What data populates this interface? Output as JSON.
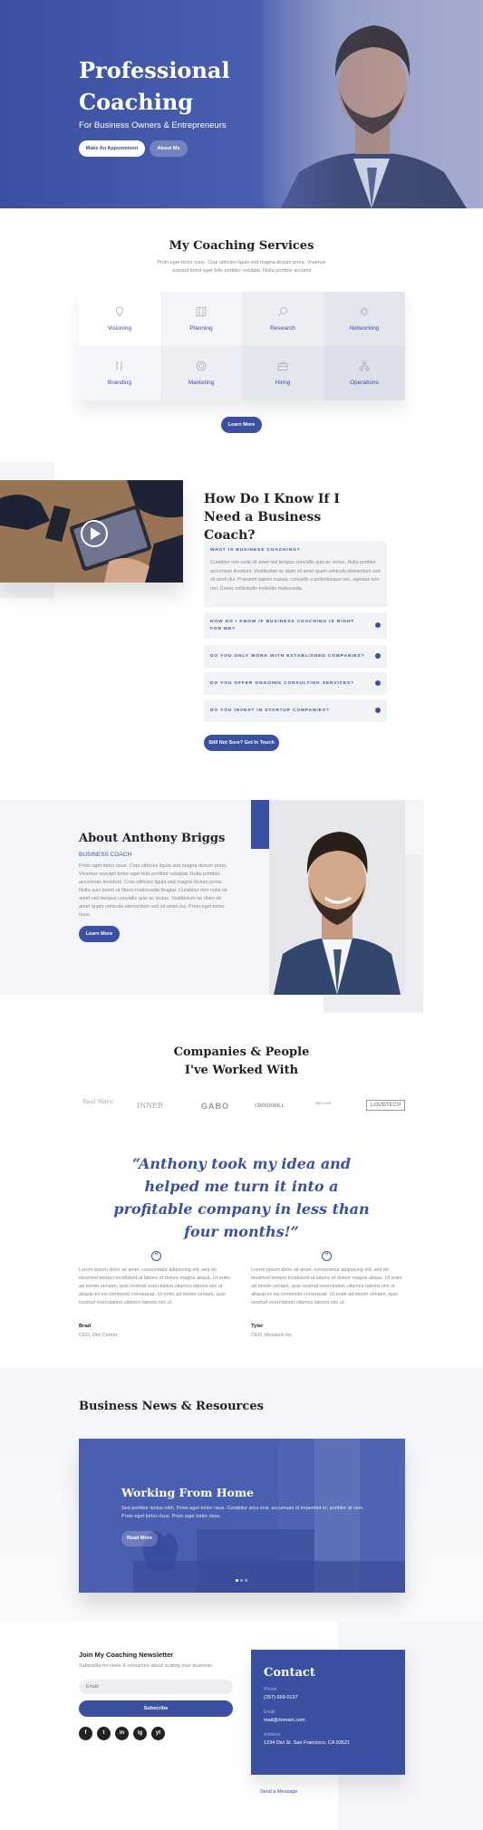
{
  "hero": {
    "title": "Professional Coaching",
    "subtitle": "For Business Owners & Entrepreneurs",
    "primary_button": "Make An Appointment",
    "secondary_button": "About Me"
  },
  "services": {
    "title": "My Coaching Services",
    "description": "Proin eget tortor risus. Cras ultricies ligula sed magna dictum porta. Vivamus suscipit tortor eget felis porttitor volutpat. Nulla porttitor accums",
    "items": [
      {
        "label": "Visioning",
        "icon": "lightbulb-icon"
      },
      {
        "label": "Planning",
        "icon": "map-icon"
      },
      {
        "label": "Research",
        "icon": "search-icon"
      },
      {
        "label": "Networking",
        "icon": "network-icon"
      },
      {
        "label": "Branding",
        "icon": "pen-icon"
      },
      {
        "label": "Marketing",
        "icon": "target-icon"
      },
      {
        "label": "Hiring",
        "icon": "briefcase-icon"
      },
      {
        "label": "Operations",
        "icon": "org-chart-icon"
      }
    ],
    "button": "Learn More"
  },
  "faq": {
    "title": "How Do I Know If I Need a Business Coach?",
    "open_question": "WHAT IS BUSINESS COACHING?",
    "open_answer": "Curabitur non nulla sit amet nisl tempus convallis quis ac lectus. Nulla porttitor accumsan tincidunt. Vestibulum ac diam sit amet quam vehicula elementum sed sit amet dui. Praesent sapien massa, convallis a pellentesque nec, egestas non nisi. Donec sollicitudin molestie malesuada.",
    "questions": [
      "HOW DO I KNOW IF BUSINESS COACHING IS RIGHT FOR ME?",
      "DO YOU ONLY WORK WITH ESTABLISHED COMPANIES?",
      "DO YOU OFFER ONGOING CONSULTING SERVICES?",
      "DO YOU INVEST IN STARTUP COMPANIES?"
    ],
    "button": "Still Not Sure? Get In Touch"
  },
  "about": {
    "title": "About Anthony Briggs",
    "subtitle": "BUSINESS COACH",
    "body": "Proin eget tortor risus. Cras ultricies ligula sed magna dictum porta. Vivamus suscipit tortor eget felis porttitor volutpat. Nulla porttitor accumsan tincidunt. Cras ultricies ligula sed magna dictum porta. Nulla quis lorem ut libero malesuada feugiat. Curabitur non nulla sit amet nisl tempus convallis quis ac lectus. Vestibulum ac diam sit amet quam vehicula elementum sed sit amet dui. Proin eget tortor risus.",
    "button": "Learn More"
  },
  "companies": {
    "title": "Companies & People I've Worked With",
    "logos": [
      "Real Wave",
      "INNER",
      "GABO",
      "CROSSWILL",
      "Zen Link",
      "LOUDTECH"
    ]
  },
  "quote": {
    "text": "“Anthony took my idea and helped me turn it into a profitable company in less than four months!”"
  },
  "testimonials": [
    {
      "text": "Lorem ipsum dolor sit amet, consectetur adipiscing elit, sed do eiusmod tempor incididunt ut labore et dolore magna aliqua. Ut enim ad minim veniam, quis nostrud exercitation ullamco laboris nisi ut aliquip ex ea commodo consequat. Ut enim ad minim veniam, quis nostrud exercitation ullamco laboris nisi ut.",
      "name": "Brad",
      "role": "CEO, Divi Corner"
    },
    {
      "text": "Lorem ipsum dolor sit amet, consectetur adipiscing elit, sed do eiusmod tempor incididunt ut labore et dolore magna aliqua. Ut enim ad minim veniam, quis nostrud exercitation ullamco laboris nisi ut aliquip ex ea commodo consequat. Ut enim ad minim veniam, quis nostrud exercitation ullamco laboris nisi ut.",
      "name": "Tyler",
      "role": "CEO, Monarch Inc"
    }
  ],
  "news": {
    "title": "Business News & Resources",
    "slide_title": "Working From Home",
    "slide_text": "Sed porttitor lectus nibh. Proin eget tortor risus. Curabitur arcu erat, accumsan id imperdiet et, porttitor at sem. Proin eget tortor risus. Proin eget tortor risus.",
    "slide_button": "Read More"
  },
  "newsletter": {
    "title": "Join My Coaching Newsletter",
    "text": "Subscribe for news & resources about scaling your business",
    "email_placeholder": "Email",
    "button": "Subscribe",
    "socials": [
      "f",
      "t",
      "in",
      "ig",
      "yt"
    ]
  },
  "contact": {
    "title": "Contact",
    "phone_label": "Phone",
    "phone": "(257) 699-0137",
    "email_label": "Email",
    "email": "mail@domain.com",
    "address_label": "Address",
    "address": "1234 Divi St. San Francisco, CA 93521",
    "send_link": "Send a Message"
  },
  "colors": {
    "accent": "#3b50a0",
    "light_bg": "#f4f5f9"
  }
}
